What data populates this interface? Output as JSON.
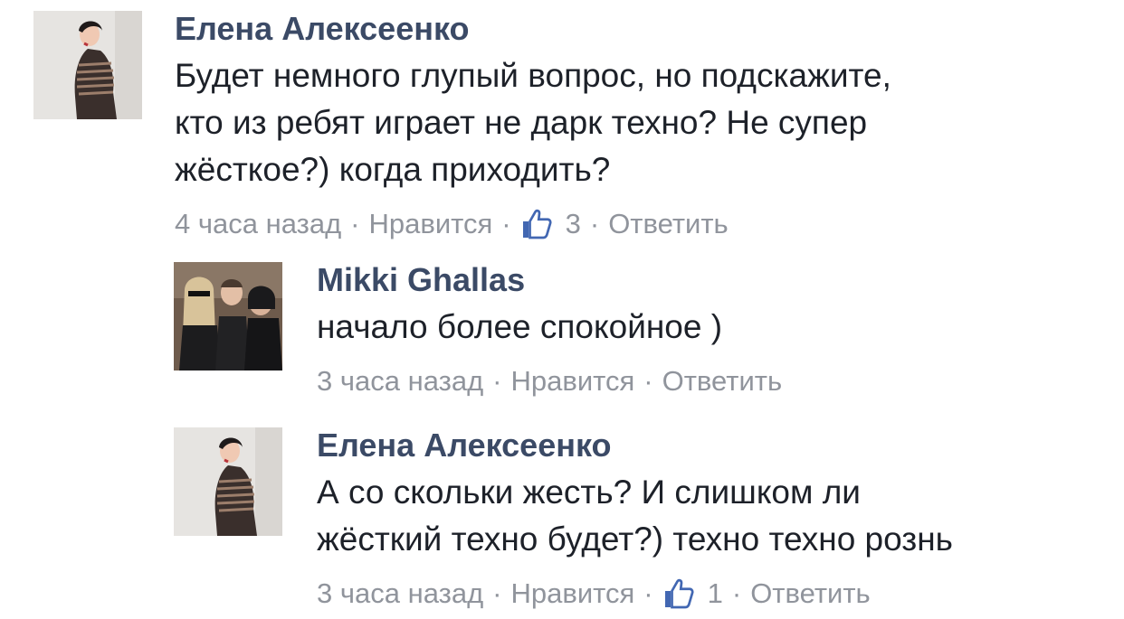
{
  "comments": [
    {
      "author": "Елена Алексеенко",
      "text_lines": [
        "Будет немного глупый вопрос, но подскажите,",
        "кто из ребят играет не дарк техно? Не супер",
        "жёсткое?) когда приходить?"
      ],
      "time": "4 часа назад",
      "like_label": "Нравится",
      "like_count": "3",
      "reply_label": "Ответить",
      "separator": "·"
    },
    {
      "author": "Mikki Ghallas",
      "text_lines": [
        "начало более спокойное )"
      ],
      "time": "3 часа назад",
      "like_label": "Нравится",
      "reply_label": "Ответить",
      "separator": "·"
    },
    {
      "author": "Елена Алексеенко",
      "text_lines": [
        "А со скольки жесть? И слишком ли",
        "жёсткий техно будет?) техно техно рознь"
      ],
      "time": "3 часа назад",
      "like_label": "Нравится",
      "like_count": "1",
      "reply_label": "Ответить",
      "separator": "·"
    }
  ],
  "colors": {
    "author": "#3b4a66",
    "text": "#1d2129",
    "meta": "#90949c",
    "like_icon": "#4267b2"
  }
}
